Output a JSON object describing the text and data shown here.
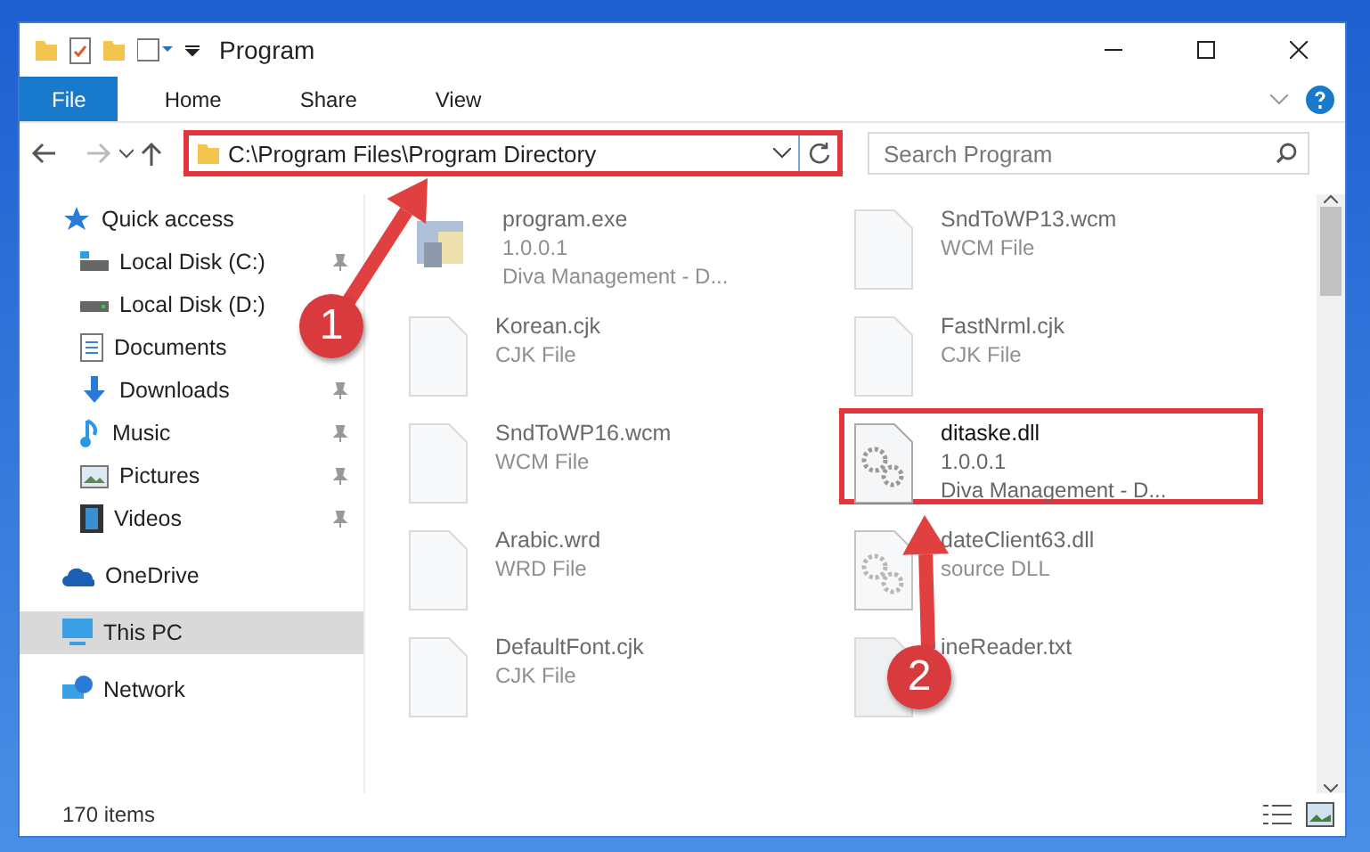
{
  "window": {
    "title": "Program"
  },
  "ribbon_tabs": [
    {
      "label": "File",
      "selected": true
    },
    {
      "label": "Home",
      "selected": false
    },
    {
      "label": "Share",
      "selected": false
    },
    {
      "label": "View",
      "selected": false
    }
  ],
  "address_bar": {
    "path": "C:\\Program Files\\Program Directory",
    "highlighted": true
  },
  "search": {
    "placeholder": "Search Program"
  },
  "sidebar": {
    "items": [
      {
        "label": "Quick access",
        "selected": false,
        "pinned": false,
        "children": [
          {
            "label": "Local Disk (C:)",
            "selected": false,
            "pinned": true
          },
          {
            "label": "Local Disk (D:)",
            "selected": false
          },
          {
            "label": "Documents",
            "selected": false
          },
          {
            "label": "Downloads",
            "selected": false,
            "pinned": true
          },
          {
            "label": "Music",
            "selected": false,
            "pinned": true
          },
          {
            "label": "Pictures",
            "selected": false,
            "pinned": true
          },
          {
            "label": "Videos",
            "selected": false,
            "pinned": true
          }
        ]
      },
      {
        "label": "OneDrive",
        "selected": false,
        "pinned": false
      },
      {
        "label": "This PC",
        "selected": true,
        "pinned": false
      },
      {
        "label": "Network",
        "selected": false,
        "pinned": false
      }
    ]
  },
  "files": [
    {
      "kind": "app",
      "name": "program.exe",
      "lines": [
        "1.0.0.1",
        "Diva Management - D..."
      ],
      "blurred": true,
      "highlighted": false
    },
    {
      "kind": "document",
      "name": "Korean.cjk",
      "lines": [
        "CJK File"
      ],
      "blurred": true,
      "highlighted": false
    },
    {
      "kind": "document",
      "name": "SndToWP16.wcm",
      "lines": [
        "WCM File"
      ],
      "blurred": true,
      "highlighted": false
    },
    {
      "kind": "document",
      "name": "Arabic.wrd",
      "lines": [
        "WRD File"
      ],
      "blurred": true,
      "highlighted": false
    },
    {
      "kind": "document",
      "name": "DefaultFont.cjk",
      "lines": [
        "CJK File"
      ],
      "blurred": true,
      "highlighted": false
    },
    {
      "kind": "document",
      "name": "SndToWP13.wcm",
      "lines": [
        "WCM File"
      ],
      "blurred": true,
      "highlighted": false
    },
    {
      "kind": "document",
      "name": "FastNrml.cjk",
      "lines": [
        "CJK File"
      ],
      "blurred": true,
      "highlighted": false
    },
    {
      "kind": "settings",
      "name": "ditaske.dll",
      "lines": [
        "1.0.0.1",
        "Diva Management - D..."
      ],
      "blurred": false,
      "highlighted": true
    },
    {
      "kind": "settings",
      "name": "dateClient63.dll",
      "lines": [
        "source DLL"
      ],
      "blurred": true,
      "highlighted": false
    },
    {
      "kind": "text",
      "name": "ineReader.txt",
      "blurred": true,
      "highlighted": false
    }
  ],
  "status_bar": {
    "text": "170 items"
  },
  "annotations": [
    {
      "label": "1"
    },
    {
      "label": "2"
    }
  ]
}
